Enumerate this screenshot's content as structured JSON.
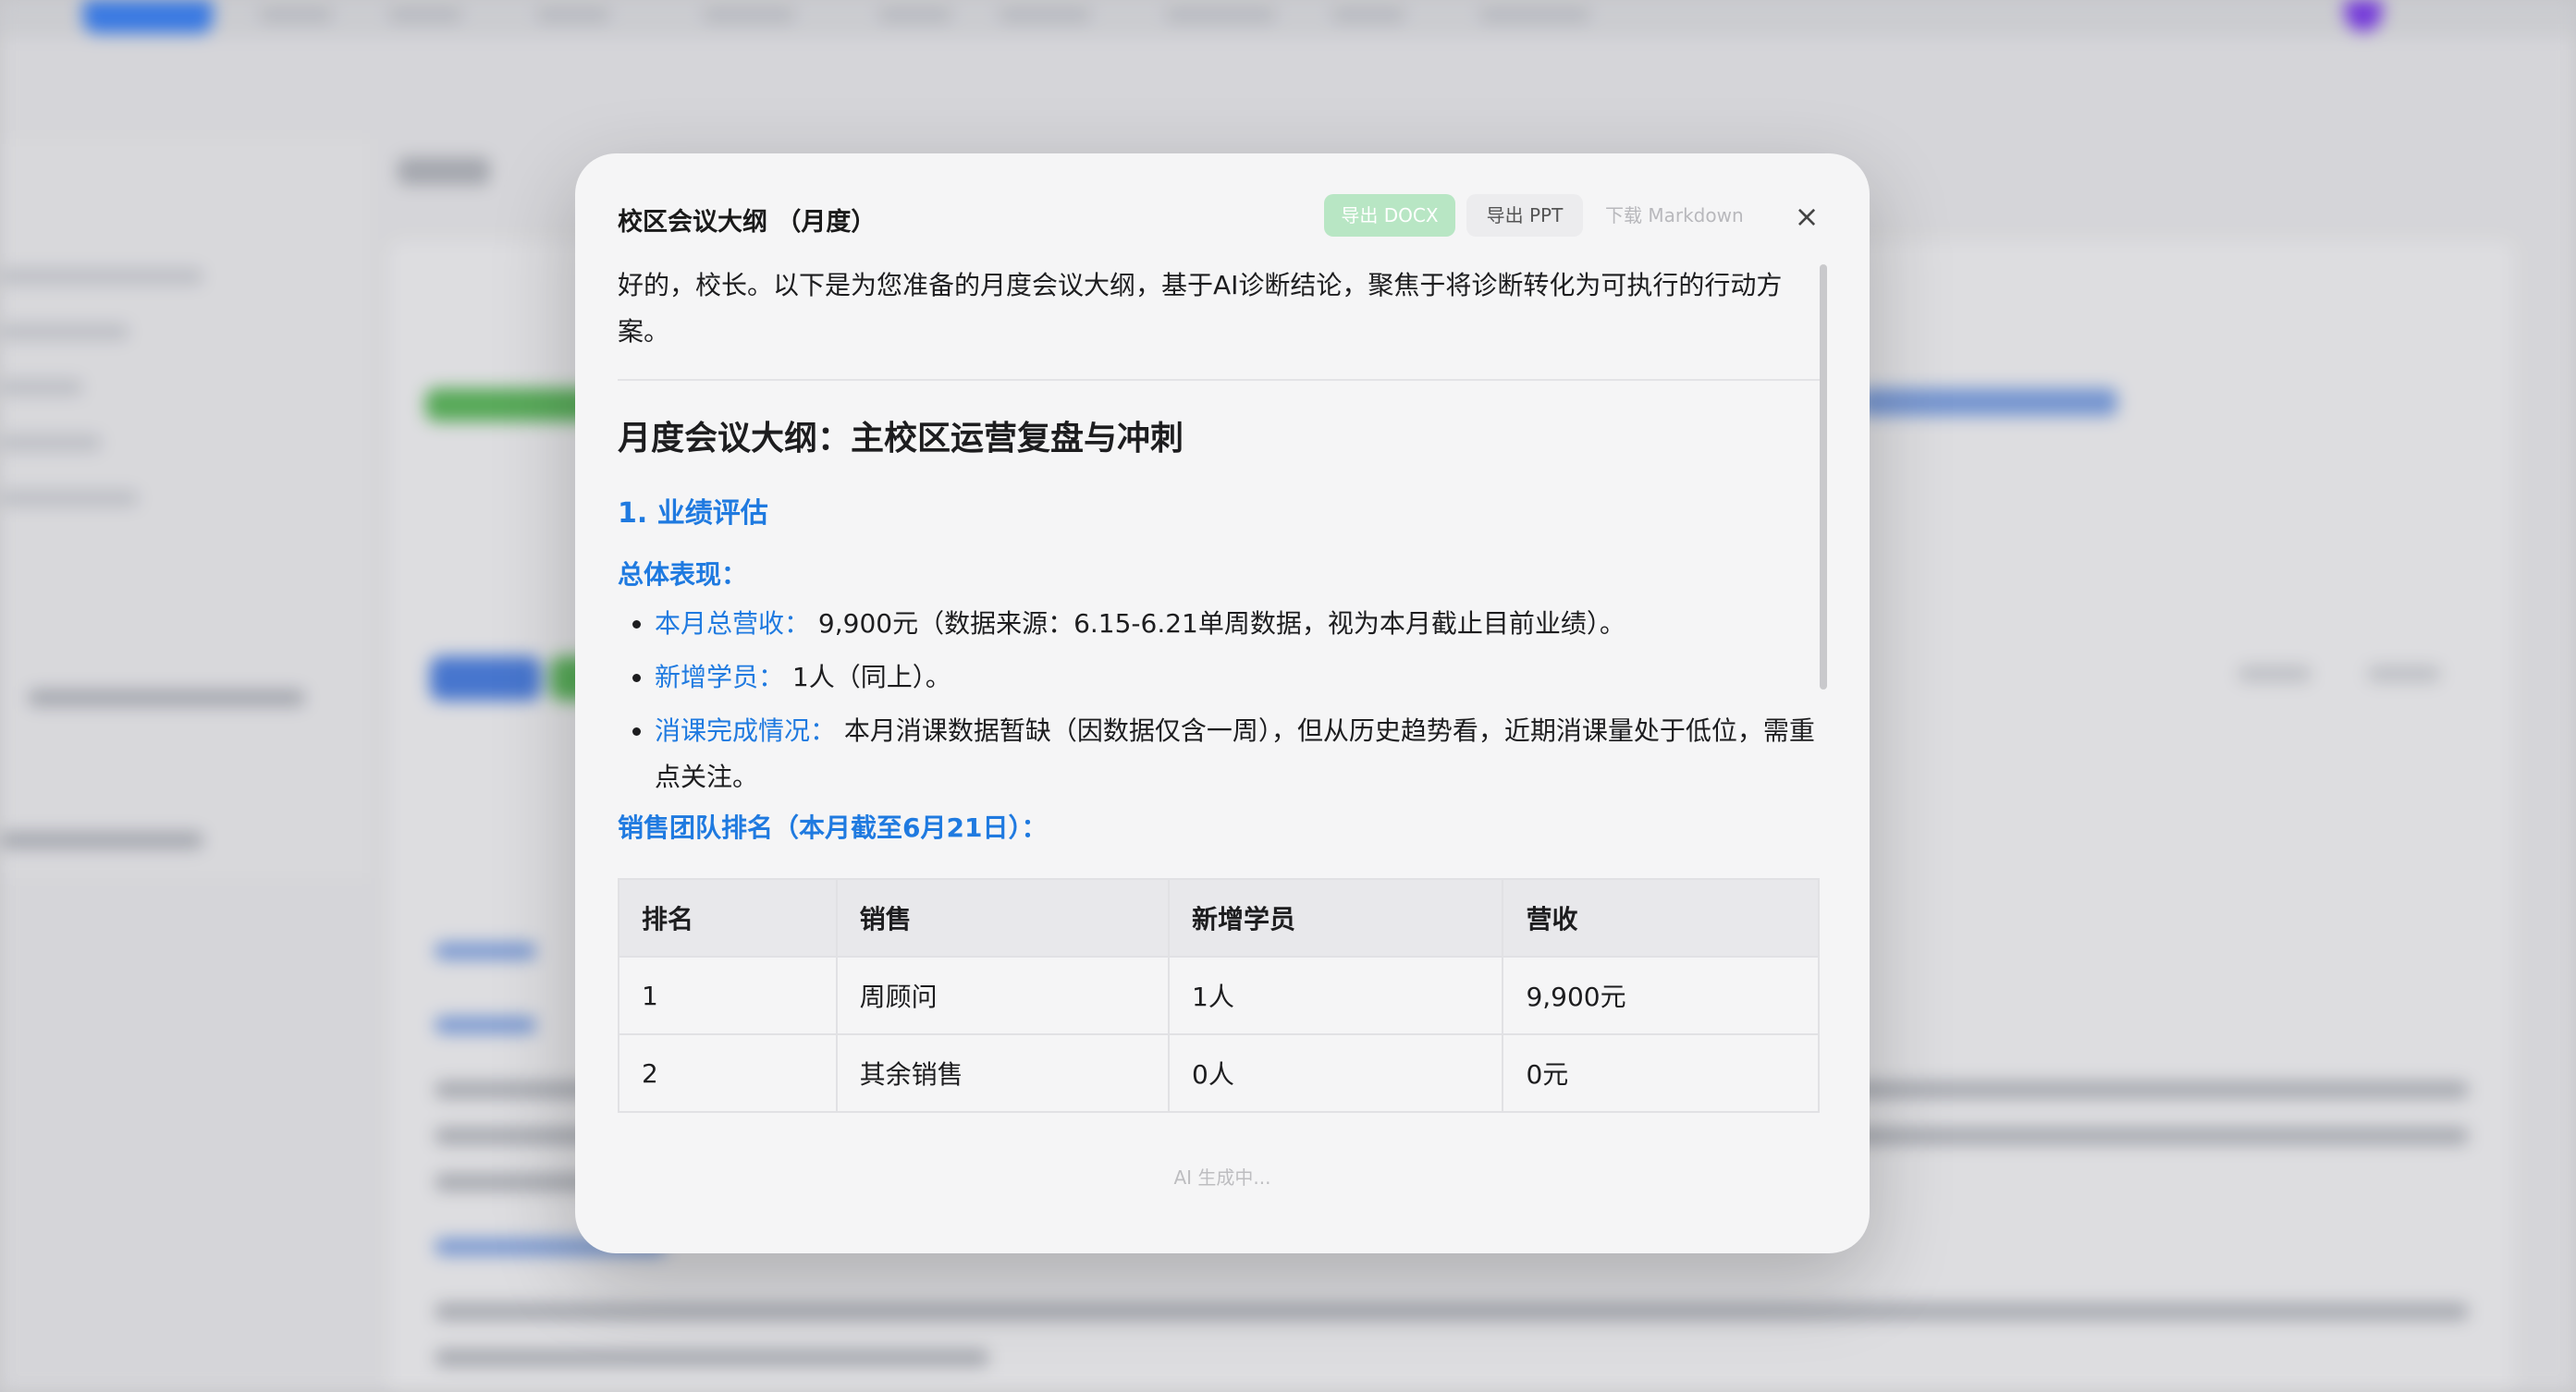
{
  "modal": {
    "title": "校区会议大纲 （月度）",
    "buttons": {
      "export_docx": "导出 DOCX",
      "export_ppt": "导出 PPT",
      "download_md": "下载 Markdown"
    },
    "close": "×",
    "status": "AI 生成中..."
  },
  "content": {
    "intro": "好的，校长。以下是为您准备的月度会议大纲，基于AI诊断结论，聚焦于将诊断转化为可执行的行动方案。",
    "heading": "月度会议大纲：主校区运营复盘与冲刺",
    "section1": "1. 业绩评估",
    "overall_label": "总体表现：",
    "bullets": [
      {
        "label": "本月总营收：",
        "text": "9,900元（数据来源：6.15-6.21单周数据，视为本月截止目前业绩）。"
      },
      {
        "label": "新增学员：",
        "text": "1人（同上）。"
      },
      {
        "label": "消课完成情况：",
        "text": "本月消课数据暂缺（因数据仅含一周），但从历史趋势看，近期消课量处于低位，需重点关注。"
      }
    ],
    "ranking_label": "销售团队排名（本月截至6月21日）：",
    "table": {
      "headers": [
        "排名",
        "销售",
        "新增学员",
        "营收"
      ],
      "rows": [
        [
          "1",
          "周顾问",
          "1人",
          "9,900元"
        ],
        [
          "2",
          "其余销售",
          "0人",
          "0元"
        ]
      ]
    }
  },
  "colors": {
    "accent": "#1f7ae0",
    "docx_button": "#b8e6c4"
  }
}
